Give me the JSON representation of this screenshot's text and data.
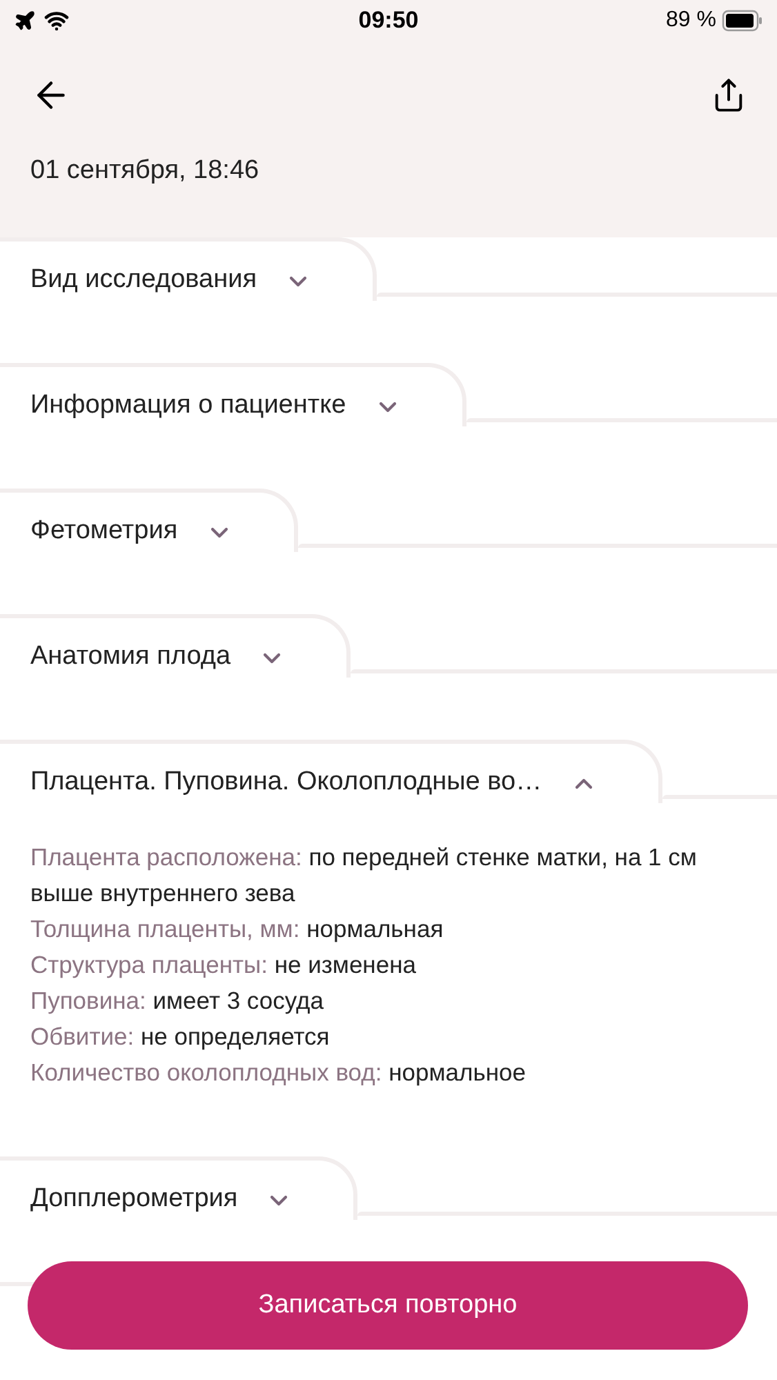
{
  "status_bar": {
    "time": "09:50",
    "battery": "89 %"
  },
  "header": {
    "date": "01 сентября, 18:46"
  },
  "sections": [
    {
      "title": "Вид исследования",
      "expanded": false
    },
    {
      "title": "Информация о пациентке",
      "expanded": false
    },
    {
      "title": "Фетометрия",
      "expanded": false
    },
    {
      "title": "Анатомия плода",
      "expanded": false
    },
    {
      "title": "Плацента. Пуповина. Околоплодные во…",
      "expanded": true,
      "fields": [
        {
          "label": "Плацента расположена:",
          "value": "по передней стенке матки, на 1 см выше внутреннего зева"
        },
        {
          "label": "Толщина плаценты, мм:",
          "value": "нормальная"
        },
        {
          "label": "Структура плаценты:",
          "value": "не изменена"
        },
        {
          "label": "Пуповина:",
          "value": "имеет 3 сосуда"
        },
        {
          "label": "Обвитие:",
          "value": "не определяется"
        },
        {
          "label": "Количество околоплодных вод:",
          "value": "нормальное"
        }
      ]
    },
    {
      "title": "Допплерометрия",
      "expanded": false
    }
  ],
  "button": {
    "label": "Записаться повторно"
  }
}
